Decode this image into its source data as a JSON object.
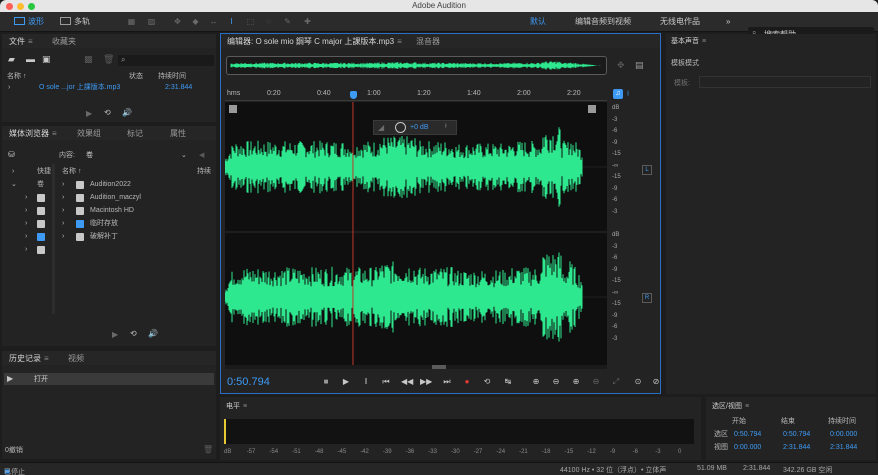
{
  "app": {
    "title": "Adobe Audition"
  },
  "toolbar": {
    "waveform_label": "波形",
    "multitrack_label": "多轨",
    "workspaces": [
      "默认",
      "编辑音频到视频",
      "无线电作品"
    ],
    "more": "»",
    "search_placeholder": "搜索帮助"
  },
  "files_panel": {
    "tabs": [
      "文件",
      "收藏夹"
    ],
    "columns": {
      "name": "名称 ↑",
      "status": "状态",
      "duration": "持续时间"
    },
    "items": [
      {
        "name": "O sole ...jor 上課版本.mp3",
        "duration": "2:31.844"
      }
    ]
  },
  "media_panel": {
    "tabs": [
      "媒体浏览器",
      "效果组",
      "标记",
      "属性"
    ],
    "content_label": "内容:",
    "content_value": "卷",
    "left_items": [
      "快捷",
      "卷"
    ],
    "columns": {
      "name": "名称 ↑",
      "duration": "持续"
    },
    "items": [
      "Audition2022",
      "Audition_maczyl",
      "Macintosh HD",
      "临时存放",
      "破解补丁"
    ]
  },
  "history_panel": {
    "tabs": [
      "历史记录",
      "视频"
    ],
    "items": [
      "打开"
    ],
    "undo_count": "0撤销"
  },
  "editor": {
    "tab_label": "编辑器: O sole mio 鋼琴 C major 上課版本.mp3",
    "mixer_label": "混音器",
    "ruler_unit": "hms",
    "ruler_ticks": [
      "0:20",
      "0:40",
      "1:00",
      "1:20",
      "1:40",
      "2:00",
      "2:20"
    ],
    "gain": "+0 dB",
    "db_scale_top": [
      "dB",
      "-3",
      "-6",
      "-9",
      "-15",
      "-∞",
      "-15",
      "-9",
      "-6",
      "-3"
    ],
    "db_scale_bottom": [
      "dB",
      "-3",
      "-6",
      "-9",
      "-15",
      "-∞",
      "-15",
      "-9",
      "-6",
      "-3"
    ],
    "channel_left": "L",
    "channel_right": "R",
    "current_time": "0:50.794",
    "playhead_fraction": 0.335,
    "waveform_color": "#2ee88f"
  },
  "essential_sound": {
    "title": "基本声音",
    "mode": "模板模式",
    "preset_label": "模板:"
  },
  "levels": {
    "title": "电平",
    "scale": [
      "dB",
      "-57",
      "-54",
      "-51",
      "-48",
      "-45",
      "-42",
      "-39",
      "-36",
      "-33",
      "-30",
      "-27",
      "-24",
      "-21",
      "-18",
      "-15",
      "-12",
      "-9",
      "-6",
      "-3",
      "0"
    ]
  },
  "selection": {
    "title": "选区/视图",
    "headers": [
      "开始",
      "结束",
      "持续时间"
    ],
    "rows": [
      {
        "label": "选区",
        "start": "0:50.794",
        "end": "0:50.794",
        "duration": "0:00.000"
      },
      {
        "label": "视图",
        "start": "0:00.000",
        "end": "2:31.844",
        "duration": "2:31.844"
      }
    ]
  },
  "status": {
    "left": "已停止",
    "format": "44100 Hz • 32 位（浮点）• 立体声",
    "size": "51.09 MB",
    "duration": "2:31.844",
    "free": "342.26 GB 空闲"
  }
}
